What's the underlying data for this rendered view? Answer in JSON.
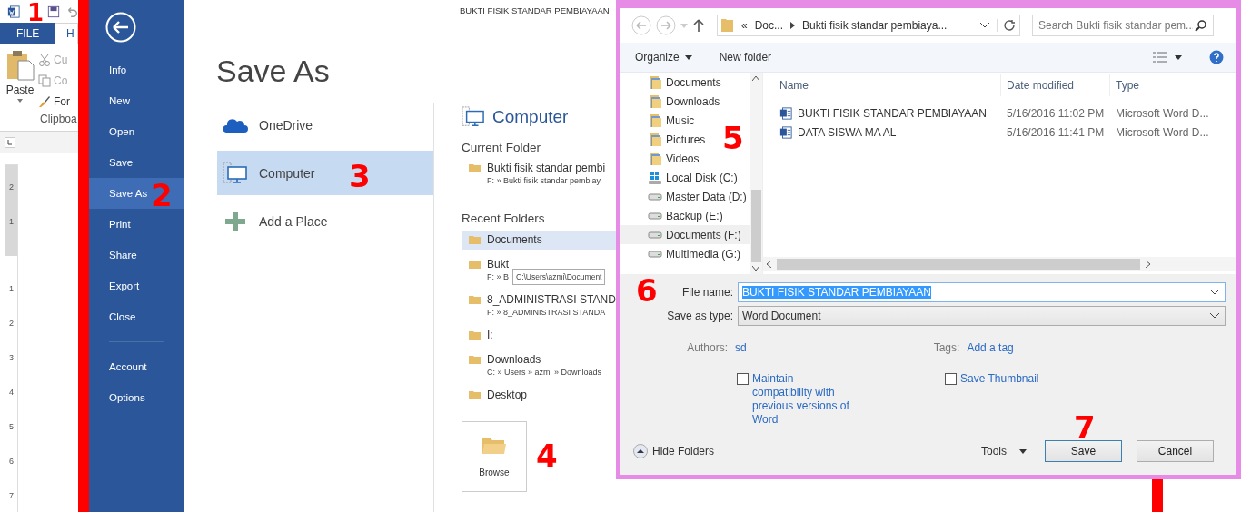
{
  "ribbon": {
    "file_tab": "FILE",
    "home_tab": "H",
    "paste": "Paste",
    "cut": "Cu",
    "copy": "Co",
    "format_painter": "For",
    "group": "Clipboa"
  },
  "ruler": {
    "upper": [
      "2",
      "1"
    ],
    "lower": [
      "1",
      "2",
      "3",
      "4",
      "5",
      "6",
      "7"
    ]
  },
  "backstage": {
    "items": [
      {
        "label": "Info",
        "selected": false
      },
      {
        "label": "New",
        "selected": false
      },
      {
        "label": "Open",
        "selected": false
      },
      {
        "label": "Save",
        "selected": false
      },
      {
        "label": "Save As",
        "selected": true
      },
      {
        "label": "Print",
        "selected": false
      },
      {
        "label": "Share",
        "selected": false
      },
      {
        "label": "Export",
        "selected": false
      },
      {
        "label": "Close",
        "selected": false
      }
    ],
    "bottom_items": [
      {
        "label": "Account",
        "selected": false
      },
      {
        "label": "Options",
        "selected": false
      }
    ]
  },
  "document_title": "BUKTI FISIK STANDAR PEMBIAYAAN",
  "page_title": "Save As",
  "places": [
    {
      "label": "OneDrive",
      "kind": "cloud",
      "selected": false
    },
    {
      "label": "Computer",
      "kind": "computer",
      "selected": true
    },
    {
      "label": "Add a Place",
      "kind": "add",
      "selected": false
    }
  ],
  "computer": {
    "heading": "Computer",
    "current_label": "Current Folder",
    "current": [
      {
        "name": "Bukti fisik standar pembi",
        "path": "F: » Bukti fisik standar pembiay"
      }
    ],
    "recent_label": "Recent Folders",
    "recent": [
      {
        "name": "Documents",
        "selected": true
      },
      {
        "name": "Bukt",
        "path": "F: » B",
        "selected": false
      },
      {
        "name": "8_ADMINISTRASI STAND",
        "path": "F: » 8_ADMINISTRASI STANDA",
        "selected": false
      },
      {
        "name": "I:",
        "selected": false
      },
      {
        "name": "Downloads",
        "path": "C: » Users » azmi » Downloads",
        "selected": false
      },
      {
        "name": "Desktop",
        "selected": false
      }
    ],
    "tooltip": "C:\\Users\\azmi\\Document",
    "browse": "Browse"
  },
  "dialog": {
    "path_overflow": "«",
    "path": [
      "Doc...",
      "Bukti fisik standar pembiaya..."
    ],
    "search_placeholder": "Search Bukti fisik standar pem...",
    "organize": "Organize",
    "new_folder": "New folder",
    "nav": [
      {
        "label": "Documents",
        "kind": "library",
        "selected": false
      },
      {
        "label": "Downloads",
        "kind": "library",
        "selected": false
      },
      {
        "label": "Music",
        "kind": "library",
        "selected": false
      },
      {
        "label": "Pictures",
        "kind": "library",
        "selected": false
      },
      {
        "label": "Videos",
        "kind": "library",
        "selected": false
      },
      {
        "label": "Local Disk (C:)",
        "kind": "system",
        "selected": false
      },
      {
        "label": "Master Data (D:)",
        "kind": "drive",
        "selected": false
      },
      {
        "label": "Backup (E:)",
        "kind": "drive",
        "selected": false
      },
      {
        "label": "Documents (F:)",
        "kind": "drive",
        "selected": true
      },
      {
        "label": "Multimedia (G:)",
        "kind": "drive",
        "selected": false
      }
    ],
    "columns": [
      "Name",
      "Date modified",
      "Type"
    ],
    "files": [
      {
        "name": "BUKTI FISIK STANDAR PEMBIAYAAN",
        "date": "5/16/2016 11:02 PM",
        "type": "Microsoft Word D..."
      },
      {
        "name": "DATA SISWA MA AL",
        "date": "5/16/2016 11:41 PM",
        "type": "Microsoft Word D..."
      }
    ],
    "file_name_label": "File name:",
    "file_name": "BUKTI FISIK STANDAR PEMBIAYAAN",
    "type_label": "Save as type:",
    "type": "Word Document",
    "authors_label": "Authors:",
    "authors": "sd",
    "tags_label": "Tags:",
    "tags": "Add a tag",
    "options": [
      {
        "label": "Maintain compatibility with previous versions of Word",
        "checked": false
      },
      {
        "label": "Save Thumbnail",
        "checked": false
      }
    ],
    "hide_folders": "Hide Folders",
    "tools": "Tools",
    "save": "Save",
    "cancel": "Cancel"
  },
  "annotations": [
    "1",
    "2",
    "3",
    "4",
    "5",
    "6",
    "7"
  ]
}
